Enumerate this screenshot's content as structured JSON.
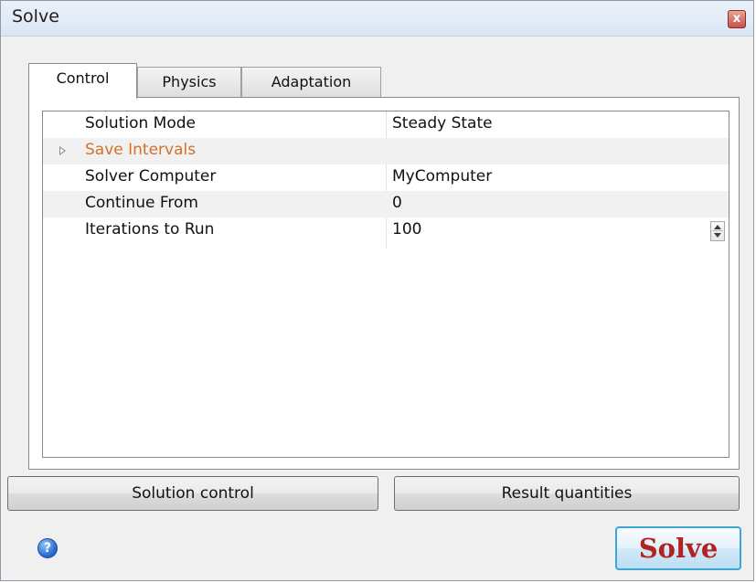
{
  "window": {
    "title": "Solve",
    "close_glyph": "x"
  },
  "tabs": [
    {
      "label": "Control",
      "active": true
    },
    {
      "label": "Physics",
      "active": false
    },
    {
      "label": "Adaptation",
      "active": false
    }
  ],
  "properties": [
    {
      "name": "Solution Mode",
      "value": "Steady State"
    },
    {
      "name": "Save Intervals",
      "value": "",
      "category": true,
      "expanded": false
    },
    {
      "name": "Solver Computer",
      "value": "MyComputer"
    },
    {
      "name": "Continue From",
      "value": "0"
    },
    {
      "name": "Iterations to Run",
      "value": "100",
      "spinner": true
    }
  ],
  "buttons": {
    "solution_control": "Solution control",
    "result_quantities": "Result quantities",
    "solve": "Solve",
    "help_glyph": "?"
  },
  "colors": {
    "category_text": "#d46f2c",
    "solve_text": "#b3221e",
    "solve_border": "#3ca6d6"
  },
  "icons": {
    "close": "close-icon",
    "help": "help-icon",
    "expander": "triangle-right-icon",
    "spinner": "spinner-icon"
  }
}
